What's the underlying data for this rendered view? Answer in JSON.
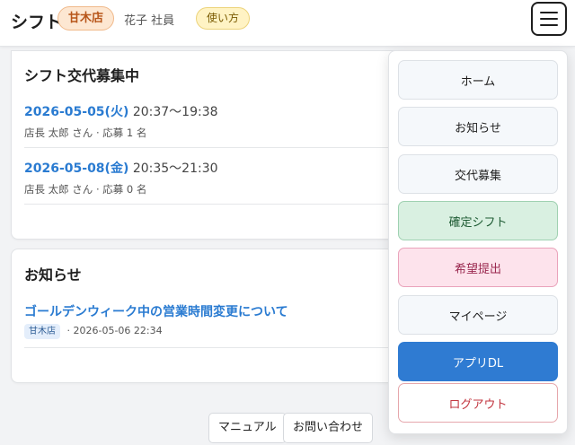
{
  "header": {
    "title": "シフト",
    "store": "甘木店",
    "user": "花子 社員",
    "help_label": "使い方",
    "menu_icon": "hamburger-icon"
  },
  "shifts": {
    "title": "シフト交代募集中",
    "items": [
      {
        "date": "2026-05-05(火)",
        "time": "20:37〜19:38",
        "meta": "店長 太郎 さん · 応募 1 名"
      },
      {
        "date": "2026-05-08(金)",
        "time": "20:35〜21:30",
        "meta": "店長 太郎 さん · 応募 0 名"
      }
    ]
  },
  "news": {
    "title": "お知らせ",
    "items": [
      {
        "title": "ゴールデンウィーク中の営業時間変更について",
        "tag": "甘木店",
        "date": "· 2026-05-06 22:34"
      }
    ]
  },
  "footer": {
    "manual": "マニュアル",
    "contact": "お問い合わせ"
  },
  "menu": {
    "items": [
      {
        "label": "ホーム"
      },
      {
        "label": "お知らせ"
      },
      {
        "label": "交代募集"
      },
      {
        "label": "確定シフト"
      },
      {
        "label": "希望提出"
      },
      {
        "label": "マイページ"
      },
      {
        "label": "アプリDL"
      },
      {
        "label": "ログアウト"
      }
    ]
  },
  "colors": {
    "accent": "#2f7bd2",
    "link": "#2a7bd1",
    "store_badge_bg": "#fde7d2",
    "help_badge_bg": "#fff3c4",
    "confirm_bg": "#d9f0e1",
    "wish_bg": "#fde3ec",
    "logout_text": "#c2353f"
  }
}
